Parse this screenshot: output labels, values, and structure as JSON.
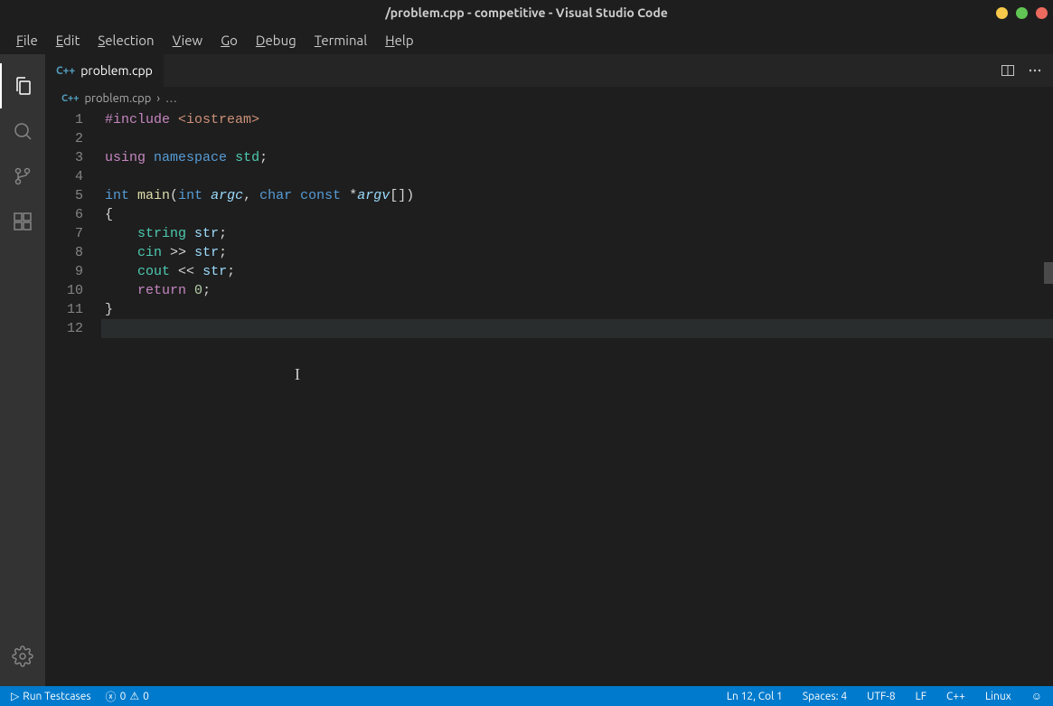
{
  "title": "/problem.cpp - competitive - Visual Studio Code",
  "menus": {
    "file": "File",
    "edit": "Edit",
    "selection": "Selection",
    "view": "View",
    "go": "Go",
    "debug": "Debug",
    "terminal": "Terminal",
    "help": "Help"
  },
  "tab": {
    "label": "problem.cpp",
    "lang": "C++"
  },
  "breadcrumb": {
    "file": "problem.cpp",
    "more": "…"
  },
  "code_lines": [
    {
      "n": "1",
      "segs": [
        {
          "c": "tk-directive",
          "t": "#include"
        },
        {
          "c": "",
          "t": " "
        },
        {
          "c": "tk-string",
          "t": "<iostream>"
        }
      ]
    },
    {
      "n": "2",
      "segs": []
    },
    {
      "n": "3",
      "segs": [
        {
          "c": "tk-keyword2",
          "t": "using"
        },
        {
          "c": "",
          "t": " "
        },
        {
          "c": "tk-keyword",
          "t": "namespace"
        },
        {
          "c": "",
          "t": " "
        },
        {
          "c": "tk-namespace",
          "t": "std"
        },
        {
          "c": "tk-punct",
          "t": ";"
        }
      ]
    },
    {
      "n": "4",
      "segs": []
    },
    {
      "n": "5",
      "segs": [
        {
          "c": "tk-type",
          "t": "int"
        },
        {
          "c": "",
          "t": " "
        },
        {
          "c": "tk-func",
          "t": "main"
        },
        {
          "c": "tk-punct",
          "t": "("
        },
        {
          "c": "tk-type",
          "t": "int"
        },
        {
          "c": "",
          "t": " "
        },
        {
          "c": "tk-param",
          "t": "argc"
        },
        {
          "c": "tk-punct",
          "t": ", "
        },
        {
          "c": "tk-type",
          "t": "char"
        },
        {
          "c": "",
          "t": " "
        },
        {
          "c": "tk-const",
          "t": "const"
        },
        {
          "c": "",
          "t": " "
        },
        {
          "c": "tk-punct",
          "t": "*"
        },
        {
          "c": "tk-param",
          "t": "argv"
        },
        {
          "c": "tk-punct",
          "t": "[])"
        }
      ]
    },
    {
      "n": "6",
      "segs": [
        {
          "c": "tk-punct",
          "t": "{"
        }
      ]
    },
    {
      "n": "7",
      "segs": [
        {
          "c": "",
          "t": "    "
        },
        {
          "c": "tk-obj",
          "t": "string"
        },
        {
          "c": "",
          "t": " "
        },
        {
          "c": "tk-var",
          "t": "str"
        },
        {
          "c": "tk-punct",
          "t": ";"
        }
      ]
    },
    {
      "n": "8",
      "segs": [
        {
          "c": "",
          "t": "    "
        },
        {
          "c": "tk-obj",
          "t": "cin"
        },
        {
          "c": "",
          "t": " "
        },
        {
          "c": "tk-punct",
          "t": ">>"
        },
        {
          "c": "",
          "t": " "
        },
        {
          "c": "tk-var",
          "t": "str"
        },
        {
          "c": "tk-punct",
          "t": ";"
        }
      ]
    },
    {
      "n": "9",
      "segs": [
        {
          "c": "",
          "t": "    "
        },
        {
          "c": "tk-obj",
          "t": "cout"
        },
        {
          "c": "",
          "t": " "
        },
        {
          "c": "tk-punct",
          "t": "<<"
        },
        {
          "c": "",
          "t": " "
        },
        {
          "c": "tk-var",
          "t": "str"
        },
        {
          "c": "tk-punct",
          "t": ";"
        }
      ]
    },
    {
      "n": "10",
      "segs": [
        {
          "c": "",
          "t": "    "
        },
        {
          "c": "tk-keyword2",
          "t": "return"
        },
        {
          "c": "",
          "t": " "
        },
        {
          "c": "tk-num",
          "t": "0"
        },
        {
          "c": "tk-punct",
          "t": ";"
        }
      ]
    },
    {
      "n": "11",
      "segs": [
        {
          "c": "tk-punct",
          "t": "}"
        }
      ]
    },
    {
      "n": "12",
      "segs": [],
      "current": true
    }
  ],
  "status": {
    "run": "Run Testcases",
    "errors": "0",
    "warnings": "0",
    "pos": "Ln 12, Col 1",
    "spaces": "Spaces: 4",
    "encoding": "UTF-8",
    "eol": "LF",
    "lang": "C++",
    "os": "Linux"
  },
  "window_colors": {
    "min": "#f6c94a",
    "max": "#61c554",
    "close": "#ed6a5e"
  }
}
